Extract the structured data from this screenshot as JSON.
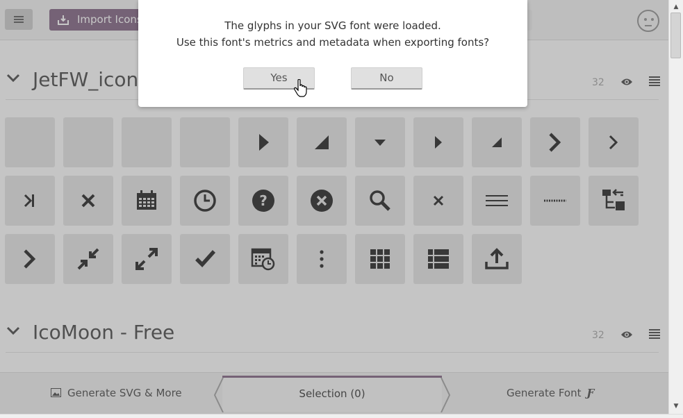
{
  "toolbar": {
    "import_label": "Import Icons"
  },
  "sets": [
    {
      "title": "JetFW_icon",
      "count": "32"
    },
    {
      "title": "IcoMoon - Free",
      "count": "32"
    }
  ],
  "glyphs": [
    "blank",
    "blank",
    "blank",
    "blank",
    "play-right",
    "triangle-corner",
    "caret-down",
    "caret-right",
    "triangle-corner-small",
    "chevron-right-bold",
    "chevron-right",
    "skip-last",
    "close-x",
    "calendar",
    "clock",
    "question-circle",
    "close-circle",
    "search",
    "close-x-small",
    "menu-lines",
    "dotted-line",
    "tree-arrange",
    "chevron-right-bold",
    "shrink",
    "enlarge",
    "checkmark",
    "calendar-clock",
    "vertical-dots",
    "grid-3x3",
    "list",
    "upload"
  ],
  "bottombar": {
    "generate_svg_label": "Generate SVG & More",
    "selection_label": "Selection (0)",
    "generate_font_label": "Generate Font",
    "generate_font_icon": "Ƒ"
  },
  "dialog": {
    "line1": "The glyphs in your SVG font were loaded.",
    "line2": "Use this font's metrics and metadata when exporting fonts?",
    "yes_label": "Yes",
    "no_label": "No"
  },
  "colors": {
    "accent": "#8a6f8c",
    "glyph": "#333333",
    "tile": "#e6e6e6"
  }
}
